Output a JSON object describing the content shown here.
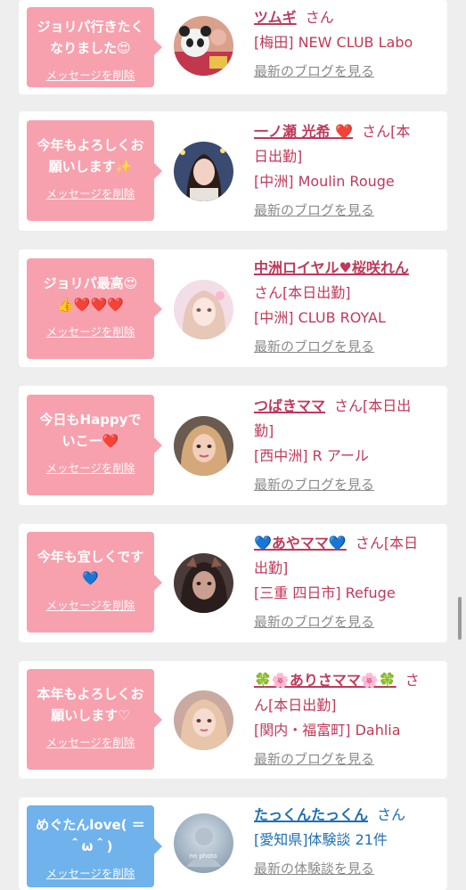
{
  "delete_label": "メッセージを削除",
  "colors": {
    "pink_bubble": "#f7a1ae",
    "blue_bubble": "#6fb2ec",
    "name_pink": "#c0395a",
    "name_blue": "#1e6fb4"
  },
  "items": [
    {
      "message_line1": "ジョリパ行きたく",
      "message_line2": "なりました😍",
      "name": "ツムギ",
      "san": "さん",
      "shop_line1": "[梅田] NEW CLUB Labo",
      "shop_line2": "",
      "link": "最新のブログを見る"
    },
    {
      "message_line1": "今年もよろしくお",
      "message_line2": "願いします✨",
      "name": "一ノ瀬 光希 ❤️",
      "san": "さん[本",
      "shop_line1": "日出勤]",
      "shop_line2": "[中洲] Moulin Rouge",
      "link": "最新のブログを見る"
    },
    {
      "message_line1": "ジョリパ最高😍",
      "message_line2": "👍❤️❤️❤️",
      "name": "中洲ロイヤル♥桜咲れん",
      "san": "さん[本日出勤]",
      "shop_line1": "[中洲] CLUB ROYAL",
      "shop_line2": "",
      "link": "最新のブログを見る"
    },
    {
      "message_line1": "今日もHappyで",
      "message_line2": "いこー❤️",
      "name": "つばきママ",
      "san": "さん[本日出",
      "shop_line1": "勤]",
      "shop_line2": "[西中洲] R アール",
      "link": "最新のブログを見る"
    },
    {
      "message_line1": "今年も宜しくです",
      "message_line2": "💙",
      "name": "💙あやママ💙",
      "san": "さん[本日",
      "shop_line1": "出勤]",
      "shop_line2": "[三重 四日市] Refuge",
      "link": "最新のブログを見る"
    },
    {
      "message_line1": "本年もよろしくお",
      "message_line2": "願いします♡",
      "name": "🍀🌸ありさママ🌸🍀",
      "san": "さ",
      "shop_line1": "ん[本日出勤]",
      "shop_line2": "[関内・福富町] Dahlia",
      "link": "最新のブログを見る"
    },
    {
      "message_line1": "めぐたんlove( ＝",
      "message_line2": "＾ω＾)",
      "name": "たっくんたっくん",
      "san": "さん",
      "shop_line1": "[愛知県]体験談 21件",
      "shop_line2": "",
      "link": "最新の体験談を見る",
      "avatar_text": "no photo"
    }
  ]
}
